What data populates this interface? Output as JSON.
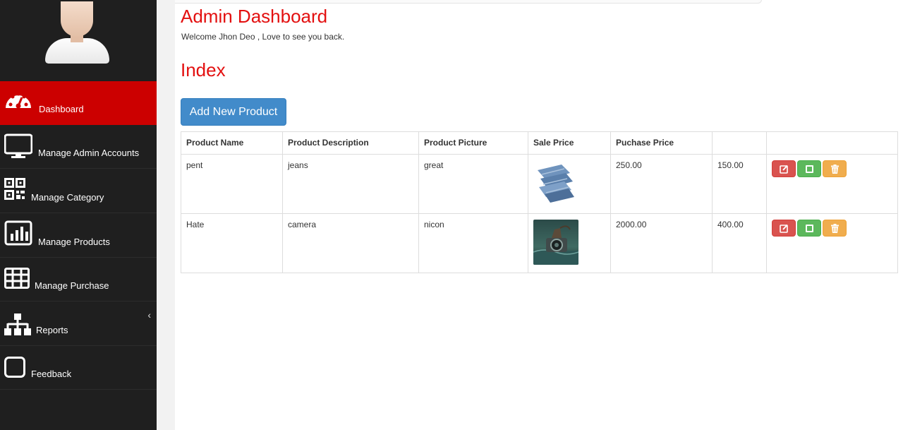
{
  "header": {
    "title": "Admin Dashboard",
    "welcome": "Welcome Jhon Deo , Love to see you back."
  },
  "sidebar": {
    "items": [
      {
        "label": "Dashboard",
        "icon": "dashboard-gauge-icon",
        "active": true
      },
      {
        "label": "Manage Admin Accounts",
        "icon": "monitor-icon"
      },
      {
        "label": "Manage Category",
        "icon": "qrcode-icon"
      },
      {
        "label": "Manage Products",
        "icon": "bar-chart-icon"
      },
      {
        "label": "Manage Purchase",
        "icon": "table-grid-icon"
      },
      {
        "label": "Reports",
        "icon": "sitemap-icon"
      },
      {
        "label": "Feedback",
        "icon": "square-outline-icon"
      }
    ],
    "collapse_caret": "‹"
  },
  "main": {
    "section_title": "Index",
    "add_button": "Add New Product",
    "table": {
      "headers": [
        "Product Name",
        "Product Description",
        "Product Picture",
        "Sale Price",
        "Puchase Price",
        "",
        ""
      ],
      "rows": [
        {
          "name": "pent",
          "description": "jeans",
          "picture_caption": "great",
          "picture": "jeans-photo",
          "sale_price": "250.00",
          "purchase_price": "150.00"
        },
        {
          "name": "Hate",
          "description": "camera",
          "picture_caption": "nicon",
          "picture": "camera-photo",
          "sale_price": "2000.00",
          "purchase_price": "400.00"
        }
      ],
      "actions": [
        "edit-icon",
        "view-icon",
        "delete-icon"
      ]
    }
  },
  "colors": {
    "accent_red": "#e31010",
    "sidebar_bg": "#1f1f1f",
    "active_item": "#cc0000",
    "primary_button": "#428bca",
    "edit_button": "#d9534f",
    "view_button": "#5cb85c",
    "delete_button": "#f0ad4e"
  }
}
